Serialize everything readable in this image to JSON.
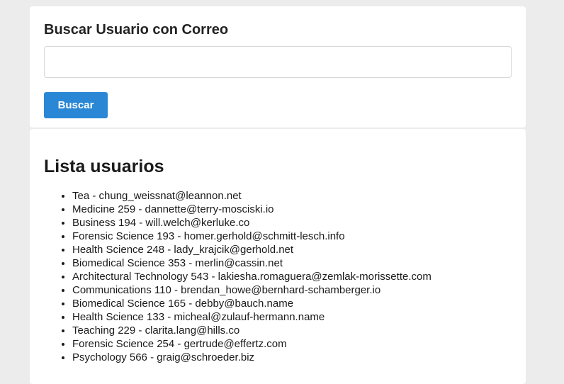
{
  "search": {
    "title": "Buscar Usuario con Correo",
    "input_value": "",
    "input_placeholder": "",
    "button_label": "Buscar"
  },
  "list": {
    "title": "Lista usuarios",
    "items": [
      "Tea - chung_weissnat@leannon.net",
      "Medicine 259 - dannette@terry-mosciski.io",
      "Business 194 - will.welch@kerluke.co",
      "Forensic Science 193 - homer.gerhold@schmitt-lesch.info",
      "Health Science 248 - lady_krajcik@gerhold.net",
      "Biomedical Science 353 - merlin@cassin.net",
      "Architectural Technology 543 - lakiesha.romaguera@zemlak-morissette.com",
      "Communications 110 - brendan_howe@bernhard-schamberger.io",
      "Biomedical Science 165 - debby@bauch.name",
      "Health Science 133 - micheal@zulauf-hermann.name",
      "Teaching 229 - clarita.lang@hills.co",
      "Forensic Science 254 - gertrude@effertz.com",
      "Psychology 566 - graig@schroeder.biz"
    ]
  },
  "colors": {
    "page_background": "#ececec",
    "card_background": "#ffffff",
    "button_background": "#2a87d6",
    "button_text": "#ffffff"
  }
}
